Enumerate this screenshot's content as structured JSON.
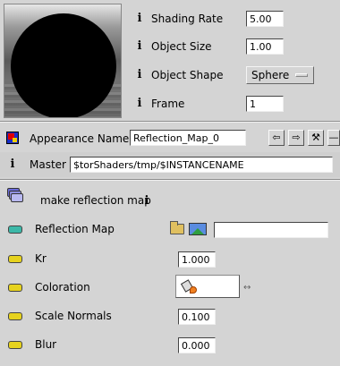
{
  "properties": {
    "shading_rate": {
      "label": "Shading Rate",
      "value": "5.00"
    },
    "object_size": {
      "label": "Object Size",
      "value": "1.00"
    },
    "object_shape": {
      "label": "Object Shape",
      "value": "Sphere"
    },
    "frame": {
      "label": "Frame",
      "value": "1"
    }
  },
  "info_glyph": "i",
  "appearance": {
    "label": "Appearance Name",
    "value": "Reflection_Map_0",
    "nav_buttons": [
      "⇦",
      "⇨",
      "⚒",
      "—"
    ]
  },
  "master": {
    "label": "Master",
    "value": "$torShaders/tmp/$INSTANCENAME"
  },
  "section": {
    "title": "make reflection map"
  },
  "params": {
    "reflection_map": {
      "label": "Reflection Map",
      "value": "",
      "color": "#3cb8a8"
    },
    "kr": {
      "label": "Kr",
      "value": "1.000",
      "color": "#e6d21e"
    },
    "coloration": {
      "label": "Coloration",
      "color": "#e6d21e"
    },
    "scale_normals": {
      "label": "Scale Normals",
      "value": "0.100",
      "color": "#e6d21e"
    },
    "blur": {
      "label": "Blur",
      "value": "0.000",
      "color": "#e6d21e"
    }
  },
  "icons": {
    "appearance": "appearance-swatch-icon",
    "section": "layers-stack-icon",
    "folder": "folder-open-icon",
    "image": "image-icon",
    "paint": "paint-bucket-icon",
    "link": "link-arrows-icon"
  }
}
